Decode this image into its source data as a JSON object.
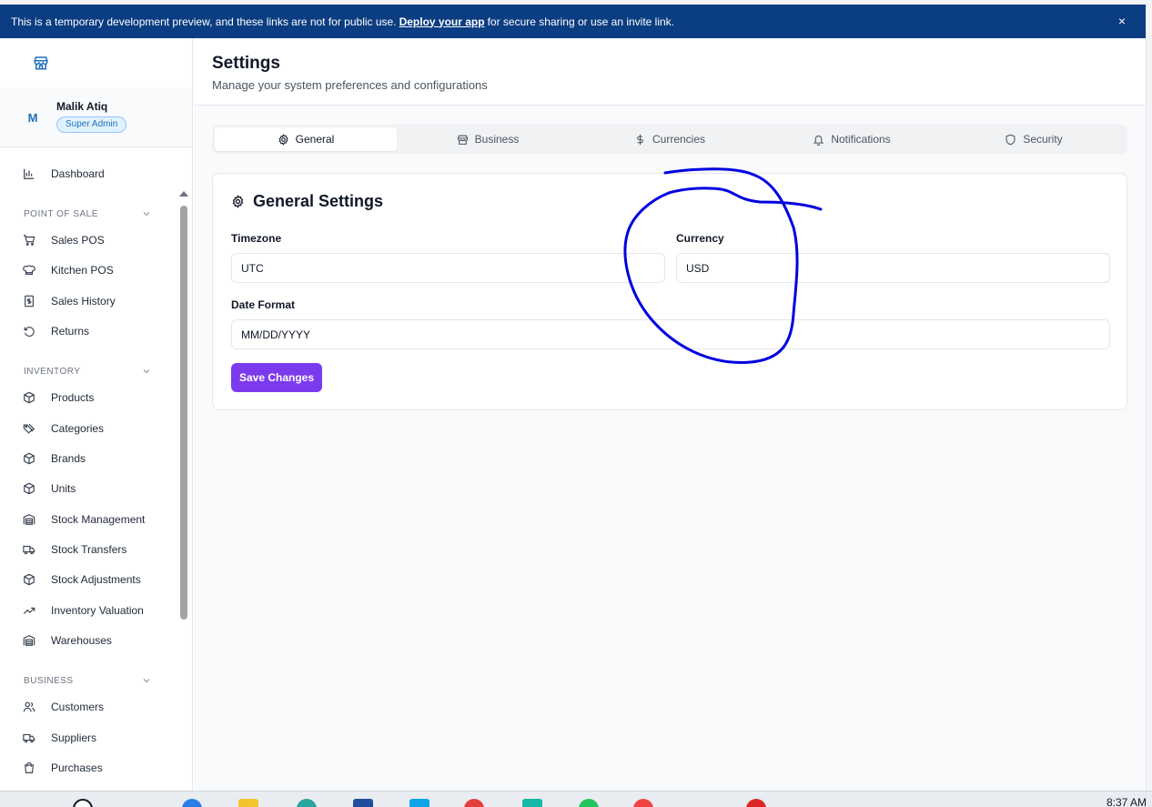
{
  "banner": {
    "text_before": "This is a temporary development preview, and these links are not for public use.",
    "link": "Deploy your app",
    "text_after": "for secure sharing or use an invite link.",
    "close": "×"
  },
  "sidebar": {
    "profile": {
      "initial": "M",
      "name": "Malik Atiq",
      "role": "Super Admin"
    },
    "dashboard": "Dashboard",
    "sections": [
      {
        "title": "Point of Sale",
        "items": [
          "Sales POS",
          "Kitchen POS",
          "Sales History",
          "Returns"
        ]
      },
      {
        "title": "Inventory",
        "items": [
          "Products",
          "Categories",
          "Brands",
          "Units",
          "Stock Management",
          "Stock Transfers",
          "Stock Adjustments",
          "Inventory Valuation",
          "Warehouses"
        ]
      },
      {
        "title": "Business",
        "items": [
          "Customers",
          "Suppliers",
          "Purchases"
        ]
      }
    ]
  },
  "header": {
    "title": "Settings",
    "subtitle": "Manage your system preferences and configurations"
  },
  "tabs": [
    {
      "label": "General",
      "icon": "gear-icon",
      "active": true
    },
    {
      "label": "Business",
      "icon": "store-icon",
      "active": false
    },
    {
      "label": "Currencies",
      "icon": "dollar-icon",
      "active": false
    },
    {
      "label": "Notifications",
      "icon": "bell-icon",
      "active": false
    },
    {
      "label": "Security",
      "icon": "shield-icon",
      "active": false
    }
  ],
  "general": {
    "title": "General Settings",
    "timezone_label": "Timezone",
    "timezone_value": "UTC",
    "currency_label": "Currency",
    "currency_value": "USD",
    "date_format_label": "Date Format",
    "date_format_value": "MM/DD/YYYY",
    "save": "Save Changes"
  },
  "taskbar": {
    "clock": "8:37 AM"
  },
  "colors": {
    "banner": "#0b3d82",
    "accent": "#7c3aed",
    "annotation": "#0000e0",
    "badge": "#1d6fb8"
  }
}
